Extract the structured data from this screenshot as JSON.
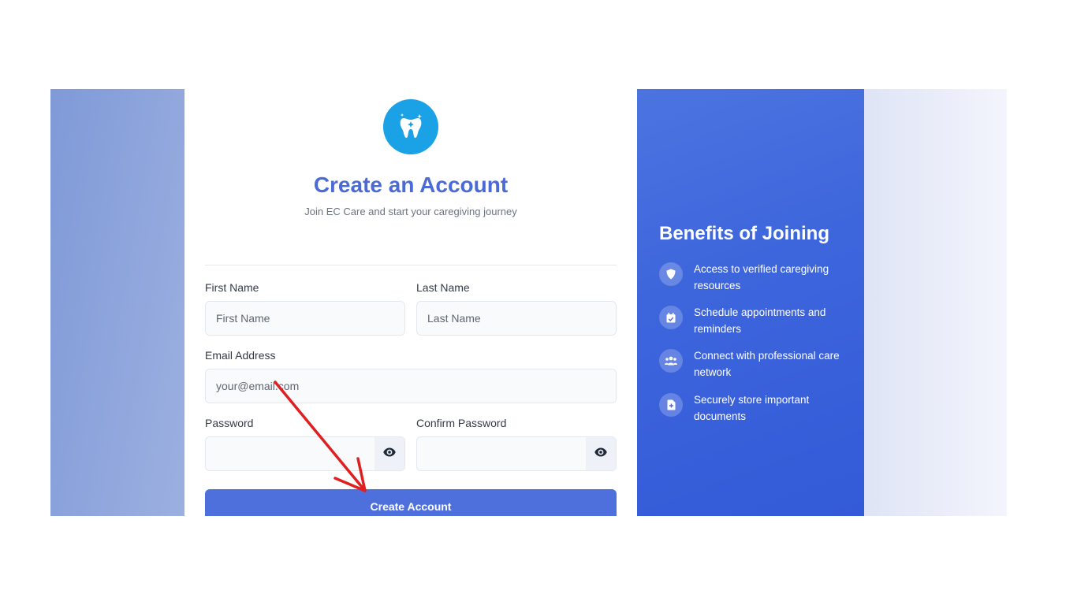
{
  "signup": {
    "title": "Create an Account",
    "subtitle": "Join EC Care and start your caregiving journey",
    "first_name": {
      "label": "First Name",
      "placeholder": "First Name",
      "value": ""
    },
    "last_name": {
      "label": "Last Name",
      "placeholder": "Last Name",
      "value": ""
    },
    "email": {
      "label": "Email Address",
      "placeholder": "your@email.com",
      "value": ""
    },
    "password": {
      "label": "Password",
      "value": ""
    },
    "confirm_password": {
      "label": "Confirm Password",
      "value": ""
    },
    "submit_label": "Create Account",
    "logo_icon": "tooth-icon",
    "toggle_icon": "eye-icon"
  },
  "benefits": {
    "title": "Benefits of Joining",
    "items": [
      {
        "icon": "shield-icon",
        "text": "Access to verified caregiving resources"
      },
      {
        "icon": "calendar-icon",
        "text": "Schedule appointments and reminders"
      },
      {
        "icon": "users-icon",
        "text": "Connect with professional care network"
      },
      {
        "icon": "document-icon",
        "text": "Securely store important documents"
      }
    ]
  },
  "colors": {
    "accent": "#4a6ad6",
    "logo_bg": "#1aa1e6",
    "button": "#4d70dc",
    "benefits_panel": "#3d65dc",
    "annotation_arrow": "#e02020"
  }
}
